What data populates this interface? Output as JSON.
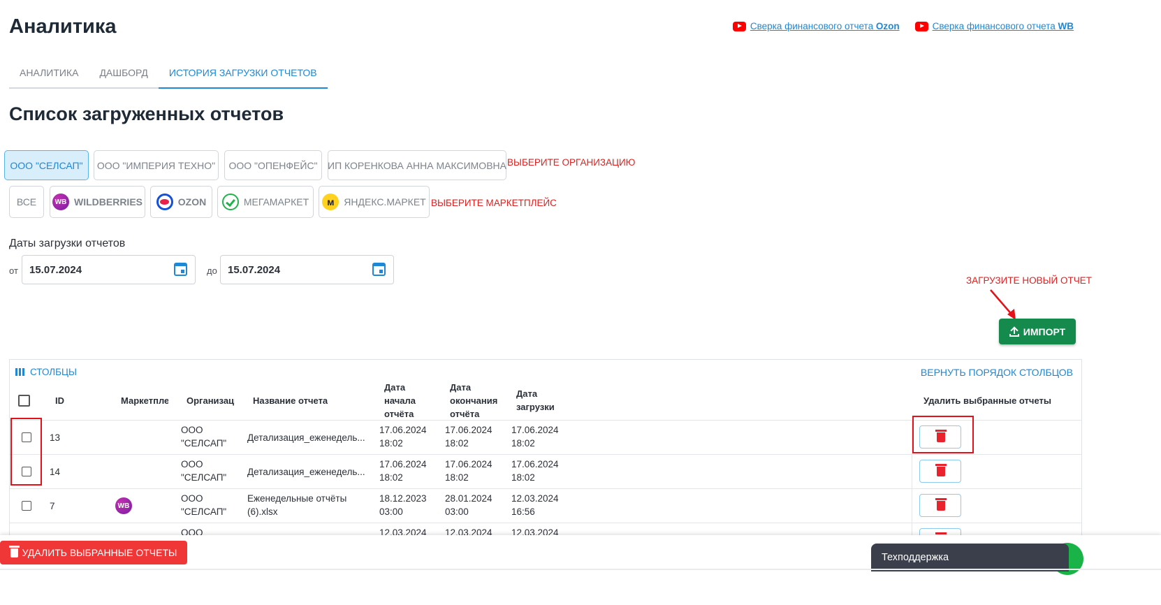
{
  "header": {
    "title": "Аналитика",
    "links": [
      {
        "text": "Сверка финансового отчета ",
        "bold": "Ozon"
      },
      {
        "text": "Сверка финансового отчета ",
        "bold": "WB"
      }
    ]
  },
  "tabs": [
    "АНАЛИТИКА",
    "ДАШБОРД",
    "ИСТОРИЯ ЗАГРУЗКИ ОТЧЕТОВ"
  ],
  "section_title": "Список загруженных отчетов",
  "organizations": {
    "items": [
      "ООО \"СЕЛСАП\"",
      "ООО \"ИМПЕРИЯ ТЕХНО\"",
      "ООО \"ОПЕНФЕЙС\"",
      "ИП КОРЕНКОВА АННА МАКСИМОВНА"
    ],
    "selected": "ООО \"СЕЛСАП\"",
    "hint": "ВЫБЕРИТЕ ОРГАНИЗАЦИЮ"
  },
  "marketplaces": {
    "items": [
      {
        "label": "ВСЕ",
        "icon": ""
      },
      {
        "label": "WILDBERRIES",
        "icon": "wb-logo-icon",
        "logo_text": "WB"
      },
      {
        "label": "OZON",
        "icon": "ozon-logo-icon"
      },
      {
        "label": "МЕГАМАРКЕТ",
        "icon": "megamarket-logo-icon"
      },
      {
        "label": "ЯНДЕКС.МАРКЕТ",
        "icon": "yandex-market-logo-icon"
      }
    ],
    "hint": "ВЫБЕРИТЕ МАРКЕТПЛЕЙС"
  },
  "dates": {
    "label": "Даты загрузки отчетов",
    "from_prefix": "от",
    "from": "15.07.2024",
    "to_prefix": "до",
    "to": "15.07.2024"
  },
  "upload_hint": "ЗАГРУЗИТЕ НОВЫЙ ОТЧЕТ",
  "import_label": "ИМПОРТ",
  "table": {
    "columns_button": "СТОЛБЦЫ",
    "reset_button": "ВЕРНУТЬ ПОРЯДОК СТОЛБЦОВ",
    "headers": {
      "id": "ID",
      "marketplace": "Маркетплейс",
      "organization": "Организация",
      "report_name": "Название отчета",
      "start_date": "Дата начала отчёта",
      "end_date": "Дата окончания отчёта",
      "upload_date": "Дата загрузки",
      "delete": "Удалить выбранные отчеты"
    },
    "rows": [
      {
        "id": "13",
        "marketplace_logo": "",
        "org_line1": "ООО",
        "org_line2": "\"СЕЛСАП\"",
        "name_line1": "Детализация_еженедель...",
        "name_line2": "",
        "start_d": "17.06.2024",
        "start_t": "18:02",
        "end_d": "17.06.2024",
        "end_t": "18:02",
        "up_d": "17.06.2024",
        "up_t": "18:02"
      },
      {
        "id": "14",
        "marketplace_logo": "",
        "org_line1": "ООО",
        "org_line2": "\"СЕЛСАП\"",
        "name_line1": "Детализация_еженедель...",
        "name_line2": "",
        "start_d": "17.06.2024",
        "start_t": "18:02",
        "end_d": "17.06.2024",
        "end_t": "18:02",
        "up_d": "17.06.2024",
        "up_t": "18:02"
      },
      {
        "id": "7",
        "marketplace_logo": "WB",
        "org_line1": "ООО",
        "org_line2": "\"СЕЛСАП\"",
        "name_line1": "Еженедельные отчёты",
        "name_line2": "(6).xlsx",
        "start_d": "18.12.2023",
        "start_t": "03:00",
        "end_d": "28.01.2024",
        "end_t": "03:00",
        "up_d": "12.03.2024",
        "up_t": "16:56"
      },
      {
        "id": "",
        "marketplace_logo": "",
        "org_line1": "ООО",
        "org_line2": "",
        "name_line1": "",
        "name_line2": "",
        "start_d": "12.03.2024",
        "start_t": "",
        "end_d": "12.03.2024",
        "end_t": "",
        "up_d": "12.03.2024",
        "up_t": ""
      }
    ]
  },
  "footer": {
    "bulk_delete": "УДАЛИТЬ ВЫБРАННЫЕ ОТЧЕТЫ",
    "support": "Техподдержка"
  },
  "colors": {
    "accent": "#1e88d6",
    "import": "#148a4c",
    "danger": "#ef3737",
    "annotation": "#e02020"
  }
}
